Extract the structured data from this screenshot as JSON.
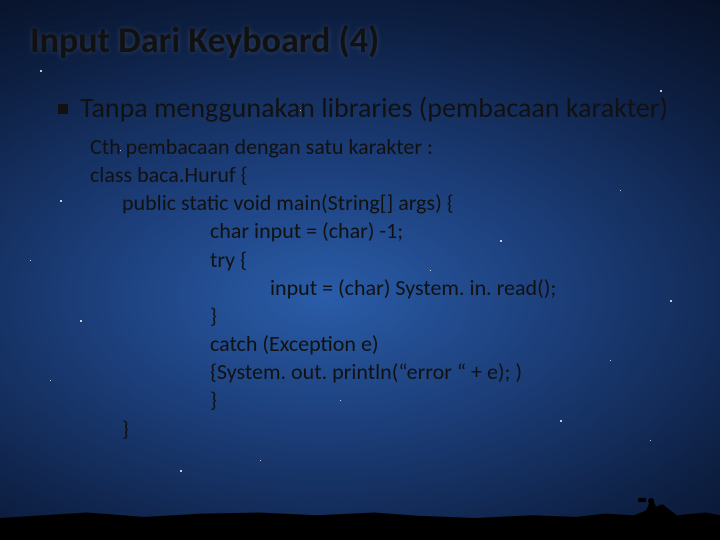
{
  "title": "Input Dari Keyboard (4)",
  "bullet": "Tanpa menggunakan libraries (pembacaan karakter)",
  "code": {
    "l1": "Cth pembacaan dengan satu karakter :",
    "l2": "class baca.Huruf {",
    "l3": "public static void main(String[] args) {",
    "l4": "char input = (char) -1;",
    "l5": "try {",
    "l6": "input = (char) System. in. read();",
    "l7": "}",
    "l8": "catch (Exception e)",
    "l9": "{System. out. println(“error “ + e); )",
    "l10": "}",
    "l11": "}"
  }
}
